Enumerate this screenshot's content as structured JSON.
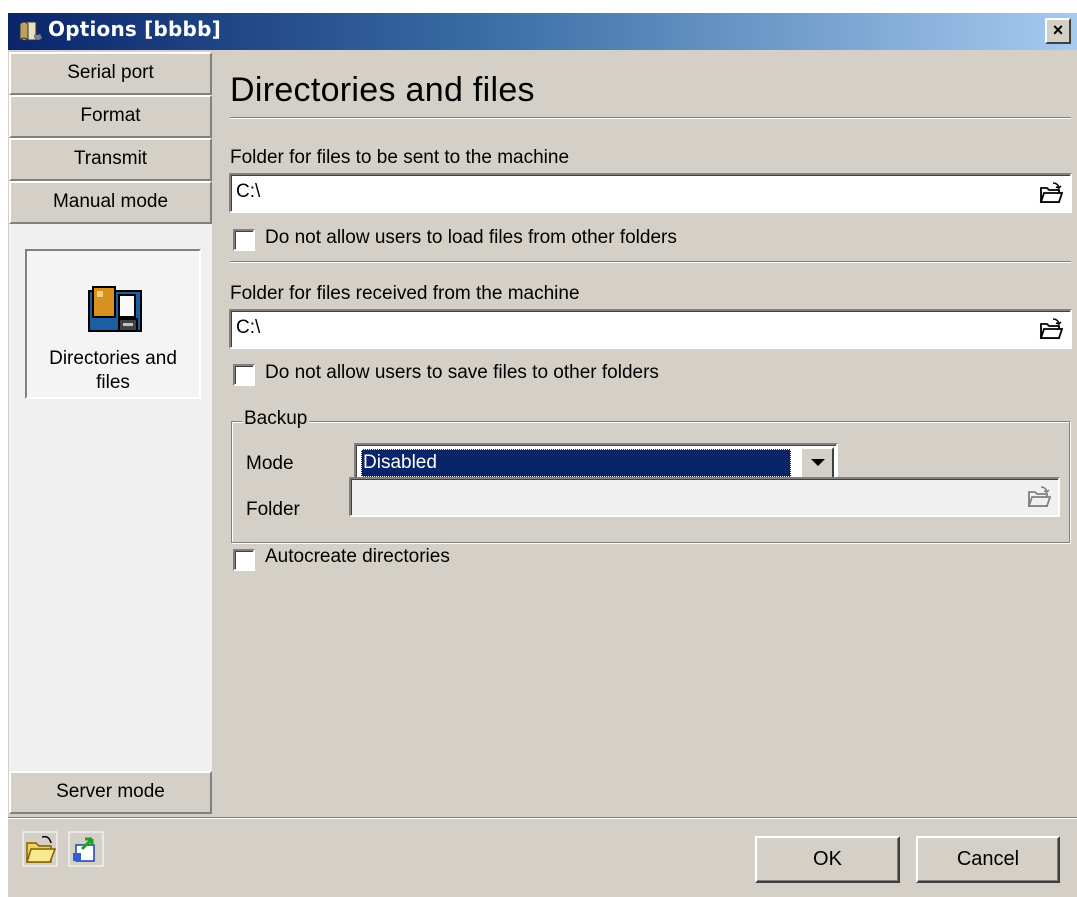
{
  "window": {
    "title": "Options [bbbb]",
    "close_label": "×"
  },
  "sidebar": {
    "items": [
      {
        "label": "Serial port"
      },
      {
        "label": "Format"
      },
      {
        "label": "Transmit"
      },
      {
        "label": "Manual mode"
      }
    ],
    "active": {
      "label": "Directories and\nfiles",
      "icon": "folder-page-icon"
    },
    "bottom_item": {
      "label": "Server mode"
    }
  },
  "main": {
    "title": "Directories and files",
    "send_folder": {
      "label": "Folder for files to be sent to the machine",
      "value": "C:\\",
      "browse_icon": "open-folder-icon",
      "restrict_label": "Do not allow users to load files from other folders",
      "restrict_checked": false
    },
    "receive_folder": {
      "label": "Folder for files received from the machine",
      "value": "C:\\",
      "browse_icon": "open-folder-icon",
      "restrict_label": "Do not allow users to save files to other folders",
      "restrict_checked": false
    },
    "backup": {
      "legend": "Backup",
      "mode_label": "Mode",
      "mode_value": "Disabled",
      "folder_label": "Folder",
      "folder_value": ""
    },
    "autocreate": {
      "label": "Autocreate directories",
      "checked": false
    }
  },
  "footer": {
    "tools": [
      {
        "icon": "open-folder-icon"
      },
      {
        "icon": "export-icon"
      }
    ],
    "ok_label": "OK",
    "cancel_label": "Cancel"
  },
  "colors": {
    "title_gradient_start": "#0a246a",
    "title_gradient_end": "#a6caf0",
    "dialog_bg": "#d4d0c8",
    "selection": "#0a246a"
  }
}
